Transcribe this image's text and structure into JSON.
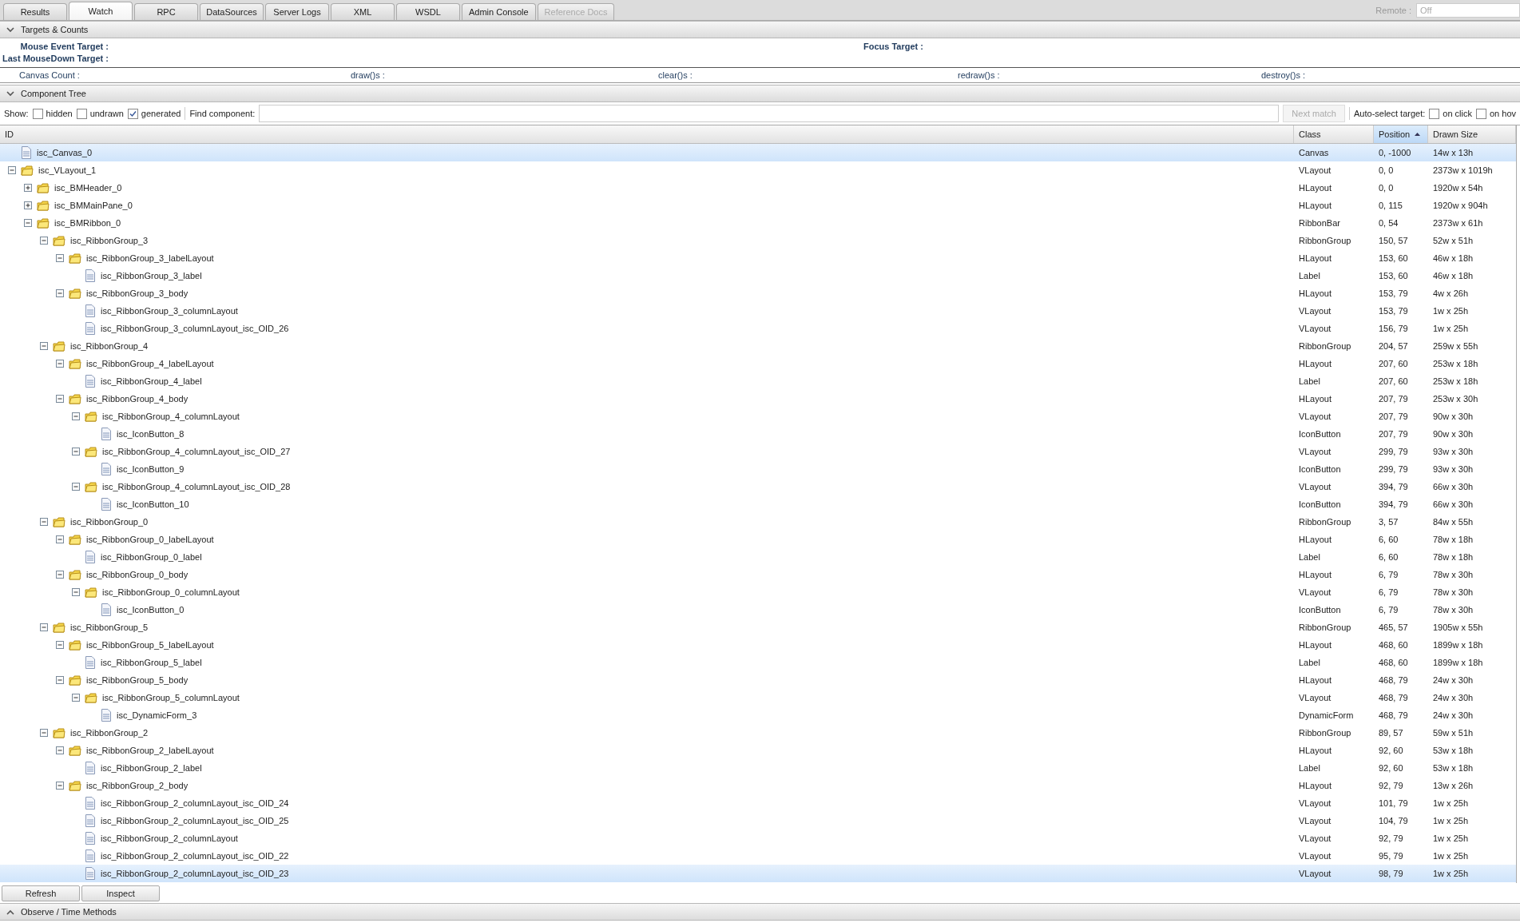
{
  "tabs": [
    {
      "label": "Results",
      "selected": false,
      "disabled": false
    },
    {
      "label": "Watch",
      "selected": true,
      "disabled": false
    },
    {
      "label": "RPC",
      "selected": false,
      "disabled": false
    },
    {
      "label": "DataSources",
      "selected": false,
      "disabled": false
    },
    {
      "label": "Server Logs",
      "selected": false,
      "disabled": false
    },
    {
      "label": "XML",
      "selected": false,
      "disabled": false
    },
    {
      "label": "WSDL",
      "selected": false,
      "disabled": false
    },
    {
      "label": "Admin Console",
      "selected": false,
      "disabled": false
    },
    {
      "label": "Reference Docs",
      "selected": false,
      "disabled": true
    }
  ],
  "remote": {
    "label": "Remote :",
    "value": "Off"
  },
  "targets_section": {
    "title": "Targets & Counts",
    "expanded": true,
    "targets": [
      "Mouse Event Target :",
      "Last MouseDown Target :"
    ],
    "focus_target": "Focus Target :",
    "counts": [
      "Canvas Count :",
      "draw()s :",
      "clear()s :",
      "redraw()s :",
      "destroy()s :"
    ]
  },
  "tree_section": {
    "title": "Component Tree",
    "expanded": true,
    "show_label": "Show:",
    "show_options": [
      {
        "label": "hidden",
        "checked": false
      },
      {
        "label": "undrawn",
        "checked": false
      },
      {
        "label": "generated",
        "checked": true
      }
    ],
    "find_label": "Find component:",
    "next_match": {
      "label": "Next match",
      "disabled": true
    },
    "auto_select_label": "Auto-select target:",
    "auto_select_options": [
      {
        "label": "on click",
        "checked": false
      },
      {
        "label": "on hov",
        "checked": false
      }
    ],
    "columns": [
      {
        "label": "ID",
        "sorted": false
      },
      {
        "label": "Class",
        "sorted": false
      },
      {
        "label": "Position",
        "sorted": true
      },
      {
        "label": "Drawn Size",
        "sorted": false
      }
    ],
    "rows": [
      {
        "id": "isc_Canvas_0",
        "class": "Canvas",
        "position": "0, -1000",
        "size": "14w x 13h",
        "kind": "page",
        "selected": true
      },
      {
        "id": "isc_VLayout_1",
        "class": "VLayout",
        "position": "0, 0",
        "size": "2373w x 1019h",
        "kind": "folder",
        "expanded": true,
        "selected": false,
        "children": [
          {
            "id": "isc_BMHeader_0",
            "class": "HLayout",
            "position": "0, 0",
            "size": "1920w x 54h",
            "kind": "folder",
            "expanded": false,
            "selected": false
          },
          {
            "id": "isc_BMMainPane_0",
            "class": "HLayout",
            "position": "0, 115",
            "size": "1920w x 904h",
            "kind": "folder",
            "expanded": false,
            "selected": false
          },
          {
            "id": "isc_BMRibbon_0",
            "class": "RibbonBar",
            "position": "0, 54",
            "size": "2373w x 61h",
            "kind": "folder",
            "expanded": true,
            "selected": false,
            "children": [
              {
                "id": "isc_RibbonGroup_3",
                "class": "RibbonGroup",
                "position": "150, 57",
                "size": "52w x 51h",
                "kind": "folder",
                "expanded": true,
                "selected": false,
                "children": [
                  {
                    "id": "isc_RibbonGroup_3_labelLayout",
                    "class": "HLayout",
                    "position": "153, 60",
                    "size": "46w x 18h",
                    "kind": "folder",
                    "expanded": true,
                    "selected": false,
                    "children": [
                      {
                        "id": "isc_RibbonGroup_3_label",
                        "class": "Label",
                        "position": "153, 60",
                        "size": "46w x 18h",
                        "kind": "page",
                        "selected": false
                      }
                    ]
                  },
                  {
                    "id": "isc_RibbonGroup_3_body",
                    "class": "HLayout",
                    "position": "153, 79",
                    "size": "4w x 26h",
                    "kind": "folder",
                    "expanded": true,
                    "selected": false,
                    "children": [
                      {
                        "id": "isc_RibbonGroup_3_columnLayout",
                        "class": "VLayout",
                        "position": "153, 79",
                        "size": "1w x 25h",
                        "kind": "page",
                        "selected": false
                      },
                      {
                        "id": "isc_RibbonGroup_3_columnLayout_isc_OID_26",
                        "class": "VLayout",
                        "position": "156, 79",
                        "size": "1w x 25h",
                        "kind": "page",
                        "selected": false
                      }
                    ]
                  }
                ]
              },
              {
                "id": "isc_RibbonGroup_4",
                "class": "RibbonGroup",
                "position": "204, 57",
                "size": "259w x 55h",
                "kind": "folder",
                "expanded": true,
                "selected": false,
                "children": [
                  {
                    "id": "isc_RibbonGroup_4_labelLayout",
                    "class": "HLayout",
                    "position": "207, 60",
                    "size": "253w x 18h",
                    "kind": "folder",
                    "expanded": true,
                    "selected": false,
                    "children": [
                      {
                        "id": "isc_RibbonGroup_4_label",
                        "class": "Label",
                        "position": "207, 60",
                        "size": "253w x 18h",
                        "kind": "page",
                        "selected": false
                      }
                    ]
                  },
                  {
                    "id": "isc_RibbonGroup_4_body",
                    "class": "HLayout",
                    "position": "207, 79",
                    "size": "253w x 30h",
                    "kind": "folder",
                    "expanded": true,
                    "selected": false,
                    "children": [
                      {
                        "id": "isc_RibbonGroup_4_columnLayout",
                        "class": "VLayout",
                        "position": "207, 79",
                        "size": "90w x 30h",
                        "kind": "folder",
                        "expanded": true,
                        "selected": false,
                        "children": [
                          {
                            "id": "isc_IconButton_8",
                            "class": "IconButton",
                            "position": "207, 79",
                            "size": "90w x 30h",
                            "kind": "page",
                            "selected": false
                          }
                        ]
                      },
                      {
                        "id": "isc_RibbonGroup_4_columnLayout_isc_OID_27",
                        "class": "VLayout",
                        "position": "299, 79",
                        "size": "93w x 30h",
                        "kind": "folder",
                        "expanded": true,
                        "selected": false,
                        "children": [
                          {
                            "id": "isc_IconButton_9",
                            "class": "IconButton",
                            "position": "299, 79",
                            "size": "93w x 30h",
                            "kind": "page",
                            "selected": false
                          }
                        ]
                      },
                      {
                        "id": "isc_RibbonGroup_4_columnLayout_isc_OID_28",
                        "class": "VLayout",
                        "position": "394, 79",
                        "size": "66w x 30h",
                        "kind": "folder",
                        "expanded": true,
                        "selected": false,
                        "children": [
                          {
                            "id": "isc_IconButton_10",
                            "class": "IconButton",
                            "position": "394, 79",
                            "size": "66w x 30h",
                            "kind": "page",
                            "selected": false
                          }
                        ]
                      }
                    ]
                  }
                ]
              },
              {
                "id": "isc_RibbonGroup_0",
                "class": "RibbonGroup",
                "position": "3, 57",
                "size": "84w x 55h",
                "kind": "folder",
                "expanded": true,
                "selected": false,
                "children": [
                  {
                    "id": "isc_RibbonGroup_0_labelLayout",
                    "class": "HLayout",
                    "position": "6, 60",
                    "size": "78w x 18h",
                    "kind": "folder",
                    "expanded": true,
                    "selected": false,
                    "children": [
                      {
                        "id": "isc_RibbonGroup_0_label",
                        "class": "Label",
                        "position": "6, 60",
                        "size": "78w x 18h",
                        "kind": "page",
                        "selected": false
                      }
                    ]
                  },
                  {
                    "id": "isc_RibbonGroup_0_body",
                    "class": "HLayout",
                    "position": "6, 79",
                    "size": "78w x 30h",
                    "kind": "folder",
                    "expanded": true,
                    "selected": false,
                    "children": [
                      {
                        "id": "isc_RibbonGroup_0_columnLayout",
                        "class": "VLayout",
                        "position": "6, 79",
                        "size": "78w x 30h",
                        "kind": "folder",
                        "expanded": true,
                        "selected": false,
                        "children": [
                          {
                            "id": "isc_IconButton_0",
                            "class": "IconButton",
                            "position": "6, 79",
                            "size": "78w x 30h",
                            "kind": "page",
                            "selected": false
                          }
                        ]
                      }
                    ]
                  }
                ]
              },
              {
                "id": "isc_RibbonGroup_5",
                "class": "RibbonGroup",
                "position": "465, 57",
                "size": "1905w x 55h",
                "kind": "folder",
                "expanded": true,
                "selected": false,
                "children": [
                  {
                    "id": "isc_RibbonGroup_5_labelLayout",
                    "class": "HLayout",
                    "position": "468, 60",
                    "size": "1899w x 18h",
                    "kind": "folder",
                    "expanded": true,
                    "selected": false,
                    "children": [
                      {
                        "id": "isc_RibbonGroup_5_label",
                        "class": "Label",
                        "position": "468, 60",
                        "size": "1899w x 18h",
                        "kind": "page",
                        "selected": false
                      }
                    ]
                  },
                  {
                    "id": "isc_RibbonGroup_5_body",
                    "class": "HLayout",
                    "position": "468, 79",
                    "size": "24w x 30h",
                    "kind": "folder",
                    "expanded": true,
                    "selected": false,
                    "children": [
                      {
                        "id": "isc_RibbonGroup_5_columnLayout",
                        "class": "VLayout",
                        "position": "468, 79",
                        "size": "24w x 30h",
                        "kind": "folder",
                        "expanded": true,
                        "selected": false,
                        "children": [
                          {
                            "id": "isc_DynamicForm_3",
                            "class": "DynamicForm",
                            "position": "468, 79",
                            "size": "24w x 30h",
                            "kind": "page",
                            "selected": false
                          }
                        ]
                      }
                    ]
                  }
                ]
              },
              {
                "id": "isc_RibbonGroup_2",
                "class": "RibbonGroup",
                "position": "89, 57",
                "size": "59w x 51h",
                "kind": "folder",
                "expanded": true,
                "selected": false,
                "children": [
                  {
                    "id": "isc_RibbonGroup_2_labelLayout",
                    "class": "HLayout",
                    "position": "92, 60",
                    "size": "53w x 18h",
                    "kind": "folder",
                    "expanded": true,
                    "selected": false,
                    "children": [
                      {
                        "id": "isc_RibbonGroup_2_label",
                        "class": "Label",
                        "position": "92, 60",
                        "size": "53w x 18h",
                        "kind": "page",
                        "selected": false
                      }
                    ]
                  },
                  {
                    "id": "isc_RibbonGroup_2_body",
                    "class": "HLayout",
                    "position": "92, 79",
                    "size": "13w x 26h",
                    "kind": "folder",
                    "expanded": true,
                    "selected": false,
                    "children": [
                      {
                        "id": "isc_RibbonGroup_2_columnLayout_isc_OID_24",
                        "class": "VLayout",
                        "position": "101, 79",
                        "size": "1w x 25h",
                        "kind": "page",
                        "selected": false
                      },
                      {
                        "id": "isc_RibbonGroup_2_columnLayout_isc_OID_25",
                        "class": "VLayout",
                        "position": "104, 79",
                        "size": "1w x 25h",
                        "kind": "page",
                        "selected": false
                      },
                      {
                        "id": "isc_RibbonGroup_2_columnLayout",
                        "class": "VLayout",
                        "position": "92, 79",
                        "size": "1w x 25h",
                        "kind": "page",
                        "selected": false
                      },
                      {
                        "id": "isc_RibbonGroup_2_columnLayout_isc_OID_22",
                        "class": "VLayout",
                        "position": "95, 79",
                        "size": "1w x 25h",
                        "kind": "page",
                        "selected": false
                      },
                      {
                        "id": "isc_RibbonGroup_2_columnLayout_isc_OID_23",
                        "class": "VLayout",
                        "position": "98, 79",
                        "size": "1w x 25h",
                        "kind": "page",
                        "selected": true
                      }
                    ]
                  }
                ]
              }
            ]
          }
        ]
      }
    ],
    "buttons": [
      "Refresh",
      "Inspect"
    ]
  },
  "observe_section": {
    "title": "Observe / Time Methods",
    "expanded": false
  }
}
